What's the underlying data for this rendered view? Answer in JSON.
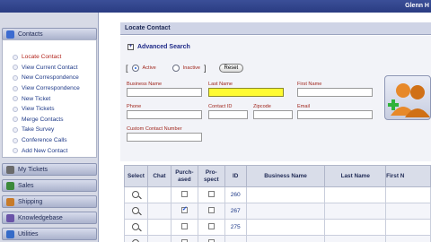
{
  "header": {
    "user": "Glenn H"
  },
  "sidebar": {
    "contacts_label": "Contacts",
    "items": [
      {
        "label": "Locate Contact",
        "active": true
      },
      {
        "label": "View Current Contact"
      },
      {
        "label": "New Correspondence"
      },
      {
        "label": "View Correspondence"
      },
      {
        "label": "New Ticket"
      },
      {
        "label": "View Tickets"
      },
      {
        "label": "Merge Contacts"
      },
      {
        "label": "Take Survey"
      },
      {
        "label": "Conference Calls"
      },
      {
        "label": "Add New Contact"
      }
    ],
    "sections": [
      {
        "label": "My Tickets",
        "color": "#6b6b6b"
      },
      {
        "label": "Sales",
        "color": "#3c8a3a"
      },
      {
        "label": "Shipping",
        "color": "#c77b2a"
      },
      {
        "label": "Knowledgebase",
        "color": "#6a53a8"
      },
      {
        "label": "Utilities",
        "color": "#356bc8"
      }
    ]
  },
  "main": {
    "title": "Locate Contact",
    "advanced_search": "Advanced Search",
    "advanced_toggle": "+",
    "status": {
      "active": "Active",
      "inactive": "Inactive",
      "selected": "Active"
    },
    "reset_label": "Reset",
    "fields": {
      "business_name": {
        "label": "Business Name",
        "value": ""
      },
      "last_name": {
        "label": "Last Name",
        "value": ""
      },
      "first_name": {
        "label": "First Name",
        "value": ""
      },
      "phone": {
        "label": "Phone",
        "value": ""
      },
      "contact_id": {
        "label": "Contact ID",
        "value": ""
      },
      "zipcode": {
        "label": "Zipcode",
        "value": ""
      },
      "email": {
        "label": "Email",
        "value": ""
      },
      "custom_contact_number": {
        "label": "Custom Contact Number",
        "value": ""
      }
    }
  },
  "table": {
    "headers": [
      "Select",
      "Chat",
      "Purch-ased",
      "Pro-spect",
      "ID",
      "Business Name",
      "Last Name",
      "First N"
    ],
    "rows": [
      {
        "purchased": false,
        "prospect": false,
        "id": "260",
        "business": "",
        "last": "",
        "first": ""
      },
      {
        "purchased": true,
        "prospect": false,
        "id": "267",
        "business": "",
        "last": "",
        "first": ""
      },
      {
        "purchased": false,
        "prospect": false,
        "id": "275",
        "business": "",
        "last": "",
        "first": ""
      },
      {
        "purchased": false,
        "prospect": false,
        "id": "",
        "business": "",
        "last": "",
        "first": ""
      }
    ]
  },
  "colors": {
    "topbar": "#2a3c82",
    "label_red": "#a0261c",
    "link_blue": "#1f3a88",
    "focus_yellow": "#fffb32"
  }
}
